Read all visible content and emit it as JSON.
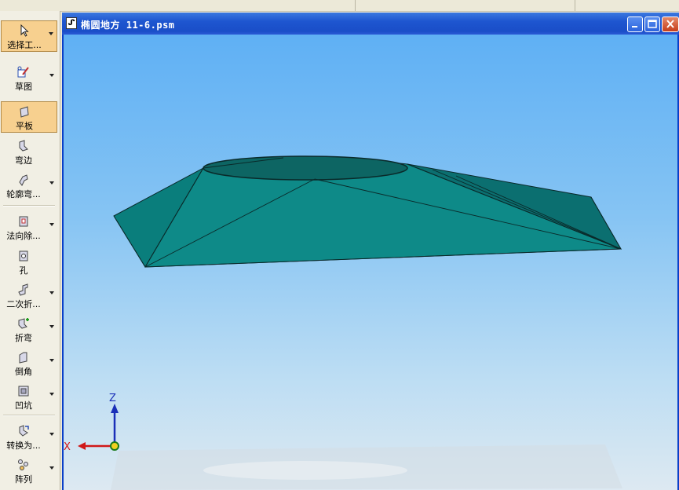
{
  "toolbar": {
    "items": [
      {
        "label": "选择工...",
        "icon": "select-arrow-icon",
        "active": true,
        "dropdown": true
      },
      {
        "label": "草图",
        "icon": "sketch-icon",
        "active": false,
        "dropdown": true
      },
      {
        "label": "平板",
        "icon": "tab-plate-icon",
        "active": true,
        "dropdown": false
      },
      {
        "label": "弯边",
        "icon": "flange-icon",
        "active": false,
        "dropdown": false
      },
      {
        "label": "轮廓弯...",
        "icon": "contour-flange-icon",
        "active": false,
        "dropdown": true
      },
      {
        "label": "法向除...",
        "icon": "normal-cutout-icon",
        "active": false,
        "dropdown": true
      },
      {
        "label": "孔",
        "icon": "hole-icon",
        "active": false,
        "dropdown": false
      },
      {
        "label": "二次折...",
        "icon": "jog-icon",
        "active": false,
        "dropdown": true
      },
      {
        "label": "折弯",
        "icon": "bend-icon",
        "active": false,
        "dropdown": true
      },
      {
        "label": "倒角",
        "icon": "chamfer-icon",
        "active": false,
        "dropdown": true
      },
      {
        "label": "凹坑",
        "icon": "dimple-icon",
        "active": false,
        "dropdown": true
      },
      {
        "label": "转换为...",
        "icon": "convert-icon",
        "active": false,
        "dropdown": true
      },
      {
        "label": "阵列",
        "icon": "pattern-icon",
        "active": false,
        "dropdown": true
      }
    ]
  },
  "document": {
    "title": "椭圆地方 11-6.psm",
    "icon": "sheetmetal-doc-icon",
    "buttons": [
      "minimize",
      "maximize",
      "close"
    ]
  },
  "triad": {
    "z_label": "Z",
    "x_label": "X"
  },
  "colors": {
    "part": "#0d8a88",
    "part_dark": "#0a6e6e",
    "title_bar": "#1e56d0",
    "toolbar_active": "#f7d08f"
  }
}
